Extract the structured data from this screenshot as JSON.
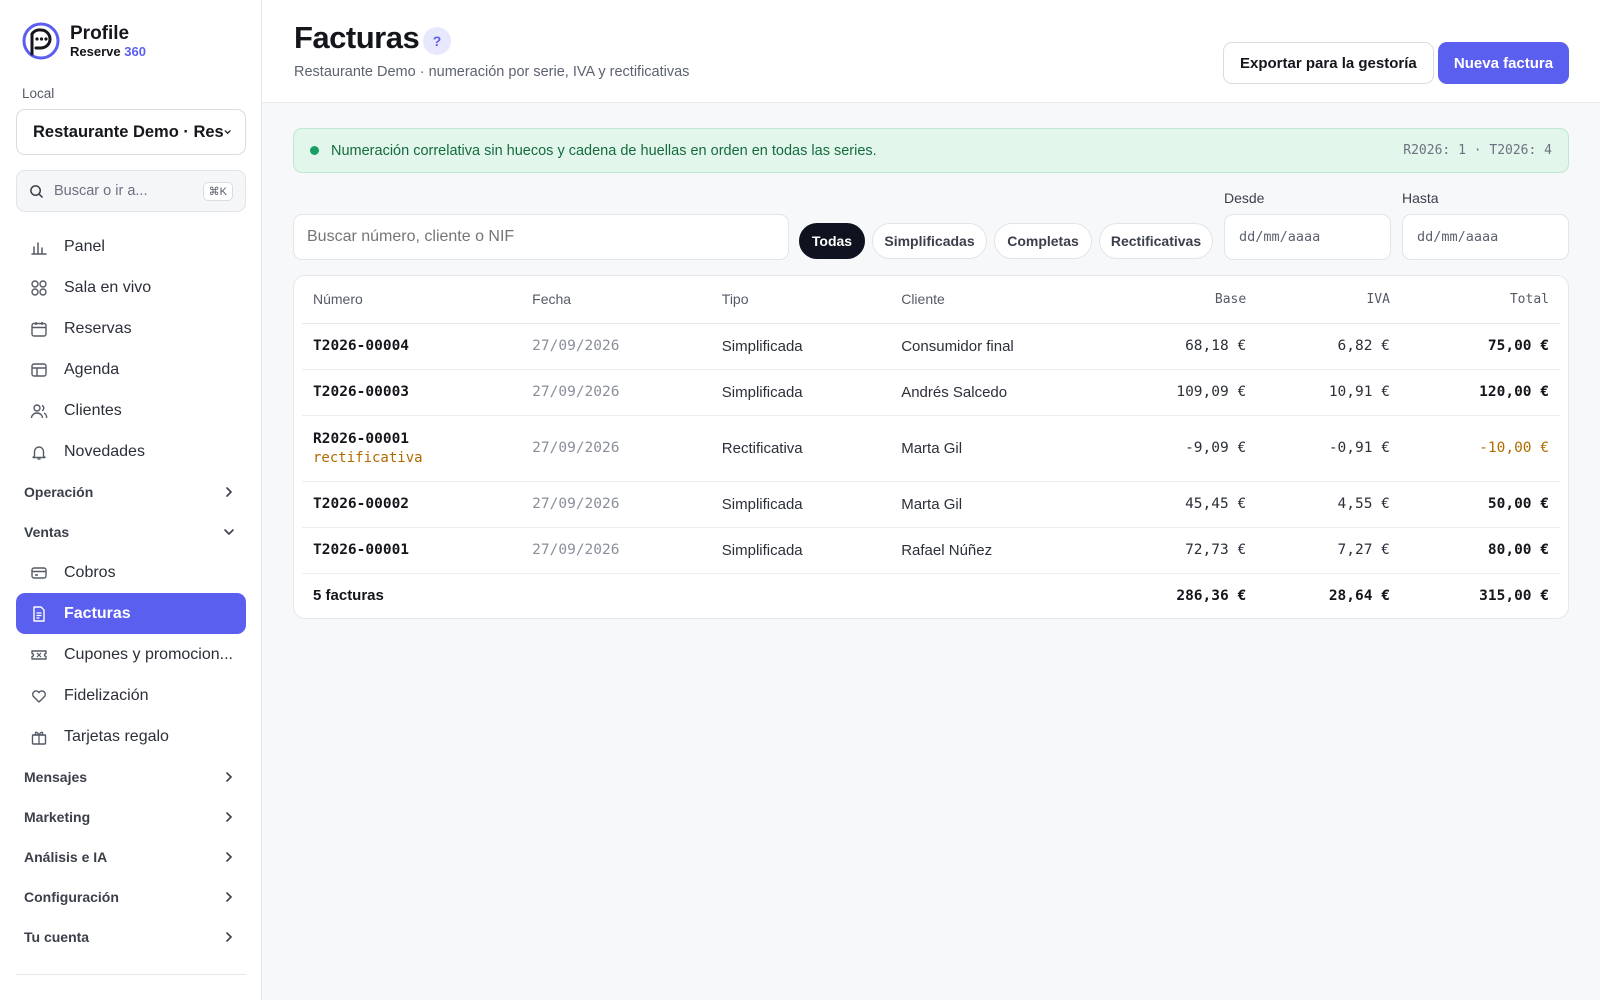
{
  "brand": {
    "name": "Profile",
    "product": "Reserve",
    "product_accent": "360"
  },
  "sidebar": {
    "local_label": "Local",
    "local_value": "Restaurante Demo · Res",
    "search_placeholder": "Buscar o ir a...",
    "search_shortcut": "⌘K",
    "items": [
      {
        "label": "Panel",
        "icon": "bar-chart-icon"
      },
      {
        "label": "Sala en vivo",
        "icon": "grid-icon"
      },
      {
        "label": "Reservas",
        "icon": "calendar-icon"
      },
      {
        "label": "Agenda",
        "icon": "table-icon"
      },
      {
        "label": "Clientes",
        "icon": "users-icon"
      },
      {
        "label": "Novedades",
        "icon": "bell-icon"
      }
    ],
    "groups": {
      "operacion": "Operación",
      "ventas": "Ventas",
      "mensajes": "Mensajes",
      "marketing": "Marketing",
      "analisis": "Análisis e IA",
      "configuracion": "Configuración",
      "cuenta": "Tu cuenta"
    },
    "ventas_items": [
      {
        "label": "Cobros",
        "icon": "card-icon"
      },
      {
        "label": "Facturas",
        "icon": "document-icon",
        "active": true
      },
      {
        "label": "Cupones y promocion...",
        "icon": "ticket-icon"
      },
      {
        "label": "Fidelización",
        "icon": "heart-icon"
      },
      {
        "label": "Tarjetas regalo",
        "icon": "gift-icon"
      }
    ]
  },
  "header": {
    "title": "Facturas",
    "help": "?",
    "subtitle": "Restaurante Demo · numeración por serie, IVA y rectificativas",
    "export_label": "Exportar para la gestoría",
    "new_label": "Nueva factura"
  },
  "banner": {
    "message": "Numeración correlativa sin huecos y cadena de huellas en orden en todas las series.",
    "counts": "R2026: 1 · T2026: 4"
  },
  "filters": {
    "search_placeholder": "Buscar número, cliente o NIF",
    "chips": [
      "Todas",
      "Simplificadas",
      "Completas",
      "Rectificativas"
    ],
    "from_label": "Desde",
    "to_label": "Hasta",
    "date_placeholder": "dd/mm/aaaa"
  },
  "table": {
    "columns": [
      "Número",
      "Fecha",
      "Tipo",
      "Cliente",
      "Base",
      "IVA",
      "Total"
    ],
    "rows": [
      {
        "number": "T2026-00004",
        "date": "27/09/2026",
        "type": "Simplificada",
        "client": "Consumidor final",
        "base": "68,18 €",
        "iva": "6,82 €",
        "total": "75,00 €"
      },
      {
        "number": "T2026-00003",
        "date": "27/09/2026",
        "type": "Simplificada",
        "client": "Andrés Salcedo",
        "base": "109,09 €",
        "iva": "10,91 €",
        "total": "120,00 €"
      },
      {
        "number": "R2026-00001",
        "tag": "rectificativa",
        "date": "27/09/2026",
        "type": "Rectificativa",
        "client": "Marta Gil",
        "base": "-9,09 €",
        "iva": "-0,91 €",
        "total": "-10,00 €"
      },
      {
        "number": "T2026-00002",
        "date": "27/09/2026",
        "type": "Simplificada",
        "client": "Marta Gil",
        "base": "45,45 €",
        "iva": "4,55 €",
        "total": "50,00 €"
      },
      {
        "number": "T2026-00001",
        "date": "27/09/2026",
        "type": "Simplificada",
        "client": "Rafael Núñez",
        "base": "72,73 €",
        "iva": "7,27 €",
        "total": "80,00 €"
      }
    ],
    "footer": {
      "count": "5 facturas",
      "base": "286,36 €",
      "iva": "28,64 €",
      "total": "315,00 €"
    }
  },
  "colors": {
    "accent": "#5b5ff0",
    "success": "#16a064",
    "negative": "#b26a00"
  }
}
